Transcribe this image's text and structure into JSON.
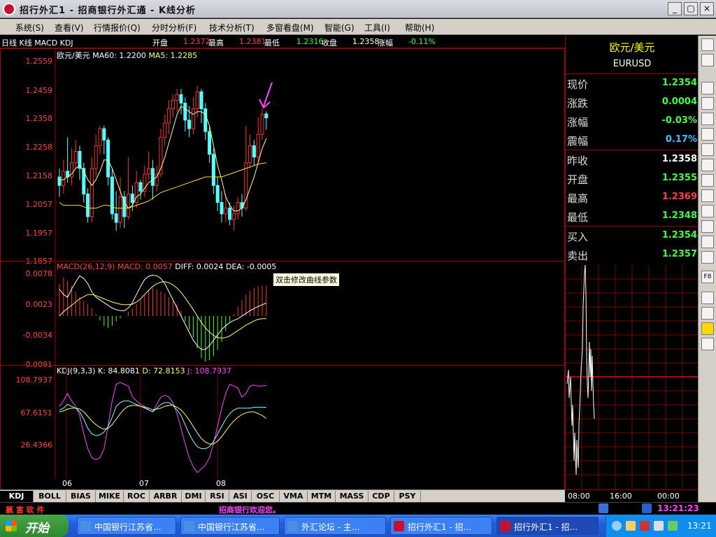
{
  "window": {
    "title": "招行外汇1 - 招商银行外汇通 - K线分析",
    "min_label": "_",
    "max_label": "▢",
    "close_label": "×"
  },
  "menu": [
    "系统(S)",
    "查看(V)",
    "行情报价(Q)",
    "分时分析(F)",
    "技术分析(T)",
    "多窗看盘(M)",
    "智能(G)",
    "工具(I)",
    "帮助(H)"
  ],
  "info": {
    "title": "日线 K线 MACD KDJ",
    "open_label": "开盘",
    "open": "1.2372",
    "high_label": "最高",
    "high": "1.2381",
    "low_label": "最低",
    "low": "1.2316",
    "close_label": "收盘",
    "close": "1.2358",
    "change_label": "涨幅",
    "change": "-0.11%"
  },
  "price_panel": {
    "legend_name": "欧元/美元",
    "ma60": "MA60: 1.2200",
    "ma5": "MA5: 1.2285",
    "y_ticks": [
      "1.2559",
      "1.2459",
      "1.2358",
      "1.2258",
      "1.2158",
      "1.2057",
      "1.1957",
      "1.1857"
    ]
  },
  "macd_panel": {
    "header": "MACD(26,12,9)",
    "macd": "MACD: 0.0057",
    "diff": "DIFF: 0.0024",
    "dea": "DEA: -0.0005",
    "y_ticks": [
      "0.0078",
      "0.0023",
      "-0.0034",
      "-0.0091"
    ],
    "tooltip": "双击修改曲线参数"
  },
  "kdj_panel": {
    "header": "KDJ(9,3,3)",
    "k": "K: 84.8081",
    "d": "D: 72.8153",
    "j": "J: 108.7937",
    "y_ticks": [
      "108.7937",
      "67.6151",
      "26.4366"
    ]
  },
  "x_ticks": [
    "06",
    "07",
    "08"
  ],
  "quote": {
    "name": "欧元/美元",
    "code": "EURUSD",
    "rows": [
      {
        "label": "现价",
        "value": "1.2354",
        "color": "#40ff40"
      },
      {
        "label": "涨跌",
        "value": "0.0004",
        "color": "#40ff40"
      },
      {
        "label": "涨幅",
        "value": "-0.03%",
        "color": "#40ff40"
      },
      {
        "label": "震幅",
        "value": "0.17%",
        "color": "#40c0ff"
      },
      {
        "label": "昨收",
        "value": "1.2358",
        "color": "#ffffff"
      },
      {
        "label": "开盘",
        "value": "1.2355",
        "color": "#40ff40"
      },
      {
        "label": "最高",
        "value": "1.2369",
        "color": "#ff4040"
      },
      {
        "label": "最低",
        "value": "1.2348",
        "color": "#40ff40"
      },
      {
        "label": "买入",
        "value": "1.2354",
        "color": "#40ff40"
      },
      {
        "label": "卖出",
        "value": "1.2357",
        "color": "#40ff40"
      }
    ]
  },
  "time_ticks": [
    "08:00",
    "16:00",
    "00:00"
  ],
  "tabs": [
    "KDJ",
    "BOLL",
    "BIAS",
    "MIKE",
    "ROC",
    "ARBR",
    "DMI",
    "RSI",
    "ASI",
    "OSC",
    "VMA",
    "MTM",
    "MASS",
    "CDP",
    "PSY"
  ],
  "status": {
    "brand": "嬴 富 软 件",
    "welcome": "招商银行欢迎您。",
    "clock": "13:21:23"
  },
  "taskbar": {
    "start": "开始",
    "tasks": [
      "中国银行江苏省...",
      "中国银行江苏省...",
      "外汇论坛 - 主...",
      "招行外汇1 - 招...",
      "招行外汇1 - 招..."
    ],
    "clock": "13:21"
  },
  "chart_data": {
    "type": "candlestick",
    "title": "日线 K线",
    "series_name": "欧元/美元",
    "ylim": [
      1.1857,
      1.2559
    ],
    "x_ticks": [
      "06",
      "07",
      "08"
    ],
    "candles": [
      [
        1.215,
        1.212,
        1.218,
        1.208
      ],
      [
        1.212,
        1.217,
        1.221,
        1.209
      ],
      [
        1.217,
        1.215,
        1.229,
        1.213
      ],
      [
        1.215,
        1.22,
        1.225,
        1.212
      ],
      [
        1.22,
        1.224,
        1.228,
        1.218
      ],
      [
        1.224,
        1.218,
        1.226,
        1.214
      ],
      [
        1.218,
        1.209,
        1.22,
        1.206
      ],
      [
        1.209,
        1.201,
        1.211,
        1.199
      ],
      [
        1.201,
        1.218,
        1.222,
        1.199
      ],
      [
        1.218,
        1.226,
        1.23,
        1.215
      ],
      [
        1.226,
        1.232,
        1.233,
        1.223
      ],
      [
        1.232,
        1.228,
        1.233,
        1.223
      ],
      [
        1.228,
        1.215,
        1.229,
        1.212
      ],
      [
        1.215,
        1.202,
        1.218,
        1.2
      ],
      [
        1.202,
        1.199,
        1.21,
        1.196
      ],
      [
        1.199,
        1.208,
        1.215,
        1.197
      ],
      [
        1.208,
        1.201,
        1.21,
        1.197
      ],
      [
        1.201,
        1.209,
        1.222,
        1.2
      ],
      [
        1.209,
        1.206,
        1.212,
        1.203
      ],
      [
        1.206,
        1.213,
        1.217,
        1.204
      ],
      [
        1.213,
        1.21,
        1.214,
        1.207
      ],
      [
        1.21,
        1.216,
        1.219,
        1.208
      ],
      [
        1.216,
        1.218,
        1.224,
        1.214
      ],
      [
        1.218,
        1.212,
        1.221,
        1.207
      ],
      [
        1.212,
        1.216,
        1.219,
        1.21
      ],
      [
        1.216,
        1.229,
        1.232,
        1.215
      ],
      [
        1.229,
        1.234,
        1.237,
        1.226
      ],
      [
        1.234,
        1.239,
        1.242,
        1.23
      ],
      [
        1.239,
        1.242,
        1.244,
        1.236
      ],
      [
        1.242,
        1.244,
        1.246,
        1.238
      ],
      [
        1.244,
        1.241,
        1.246,
        1.237
      ],
      [
        1.241,
        1.235,
        1.243,
        1.231
      ],
      [
        1.235,
        1.232,
        1.24,
        1.229
      ],
      [
        1.232,
        1.239,
        1.243,
        1.23
      ],
      [
        1.239,
        1.245,
        1.247,
        1.236
      ],
      [
        1.245,
        1.239,
        1.246,
        1.234
      ],
      [
        1.239,
        1.231,
        1.241,
        1.228
      ],
      [
        1.231,
        1.223,
        1.233,
        1.22
      ],
      [
        1.223,
        1.212,
        1.225,
        1.209
      ],
      [
        1.212,
        1.206,
        1.215,
        1.203
      ],
      [
        1.206,
        1.202,
        1.21,
        1.199
      ],
      [
        1.202,
        1.204,
        1.209,
        1.199
      ],
      [
        1.204,
        1.2,
        1.206,
        1.198
      ],
      [
        1.2,
        1.202,
        1.205,
        1.196
      ],
      [
        1.202,
        1.206,
        1.208,
        1.2
      ],
      [
        1.206,
        1.204,
        1.209,
        1.201
      ],
      [
        1.204,
        1.22,
        1.233,
        1.203
      ],
      [
        1.22,
        1.226,
        1.23,
        1.218
      ],
      [
        1.226,
        1.222,
        1.228,
        1.219
      ],
      [
        1.222,
        1.23,
        1.236,
        1.22
      ],
      [
        1.23,
        1.237,
        1.239,
        1.228
      ],
      [
        1.2372,
        1.2358,
        1.2381,
        1.2316
      ]
    ],
    "ma5": [
      1.214,
      1.214,
      1.215,
      1.216,
      1.218,
      1.219,
      1.217,
      1.214,
      1.212,
      1.214,
      1.217,
      1.221,
      1.221,
      1.218,
      1.214,
      1.21,
      1.206,
      1.204,
      1.205,
      1.208,
      1.209,
      1.211,
      1.213,
      1.214,
      1.215,
      1.218,
      1.222,
      1.227,
      1.232,
      1.237,
      1.24,
      1.239,
      1.238,
      1.237,
      1.238,
      1.238,
      1.237,
      1.233,
      1.226,
      1.219,
      1.214,
      1.208,
      1.205,
      1.203,
      1.203,
      1.204,
      1.207,
      1.211,
      1.215,
      1.22,
      1.225,
      1.2285
    ],
    "ma60": [
      1.206,
      1.205,
      1.205,
      1.205,
      1.205,
      1.205,
      1.2045,
      1.204,
      1.204,
      1.204,
      1.2045,
      1.205,
      1.205,
      1.2045,
      1.204,
      1.204,
      1.204,
      1.204,
      1.2045,
      1.205,
      1.2055,
      1.206,
      1.2065,
      1.2075,
      1.2085,
      1.2095,
      1.21,
      1.2105,
      1.211,
      1.2115,
      1.212,
      1.2125,
      1.213,
      1.2135,
      1.214,
      1.2145,
      1.215,
      1.215,
      1.215,
      1.215,
      1.215,
      1.2155,
      1.216,
      1.2165,
      1.217,
      1.2175,
      1.218,
      1.2185,
      1.219,
      1.2195,
      1.2198,
      1.22
    ],
    "macd_ylim": [
      -0.0091,
      0.0078
    ],
    "macd_hist": [
      0.006,
      0.0072,
      0.0066,
      0.0056,
      0.0045,
      0.0035,
      0.0028,
      0.0022,
      0.0014,
      0.0004,
      -0.0008,
      -0.0018,
      -0.0022,
      -0.0018,
      -0.001,
      -0.0004,
      0.0,
      0.0008,
      0.0014,
      0.0022,
      0.003,
      0.004,
      0.0048,
      0.0052,
      0.005,
      0.0046,
      0.0042,
      0.0035,
      0.0028,
      0.0022,
      0.001,
      -0.001,
      -0.0025,
      -0.004,
      -0.006,
      -0.0078,
      -0.0085,
      -0.0082,
      -0.0074,
      -0.0063,
      -0.0048,
      -0.0028,
      -0.001,
      0.0004,
      0.0018,
      0.003,
      0.004,
      0.0047,
      0.0052,
      0.0055,
      0.0057,
      0.0057
    ],
    "macd_diff": [
      0.005,
      0.004,
      0.0035,
      0.005,
      0.0063,
      0.0075,
      0.007,
      0.006,
      0.0045,
      0.0035,
      0.003,
      0.0025,
      0.002,
      0.0015,
      0.0012,
      0.001,
      0.001,
      0.0015,
      0.0025,
      0.004,
      0.0055,
      0.0068,
      0.0074,
      0.0076,
      0.0075,
      0.007,
      0.006,
      0.0045,
      0.003,
      0.0015,
      0.0,
      -0.0015,
      -0.003,
      -0.0045,
      -0.0055,
      -0.0062,
      -0.0062,
      -0.0055,
      -0.0045,
      -0.0035,
      -0.0025,
      -0.0018,
      -0.0012,
      -0.0008,
      -0.0005,
      0.0,
      0.0005,
      0.001,
      0.0014,
      0.0018,
      0.0021,
      0.0024
    ],
    "macd_dea": [
      0.0,
      0.0008,
      0.0014,
      0.002,
      0.0026,
      0.0032,
      0.0036,
      0.004,
      0.004,
      0.0038,
      0.0035,
      0.0032,
      0.0029,
      0.0026,
      0.0024,
      0.0022,
      0.0021,
      0.0021,
      0.0022,
      0.0026,
      0.0032,
      0.004,
      0.0048,
      0.0055,
      0.006,
      0.0063,
      0.0064,
      0.0062,
      0.0058,
      0.0052,
      0.0044,
      0.0034,
      0.0023,
      0.0012,
      0.0,
      -0.0012,
      -0.0022,
      -0.003,
      -0.0036,
      -0.004,
      -0.0041,
      -0.004,
      -0.0037,
      -0.0032,
      -0.0027,
      -0.0022,
      -0.0017,
      -0.0013,
      -0.0009,
      -0.0006,
      -0.0005,
      -0.0005
    ],
    "kdj_ylim": [
      10,
      118
    ],
    "kdj_k": [
      82,
      84,
      88,
      86,
      84,
      80,
      72,
      62,
      56,
      54,
      55,
      58,
      64,
      74,
      86,
      90,
      92,
      92,
      90,
      88,
      86,
      84,
      82,
      80,
      84,
      88,
      90,
      90,
      87,
      82,
      76,
      66,
      56,
      48,
      42,
      40,
      40,
      42,
      48,
      56,
      64,
      72,
      78,
      82,
      84,
      84,
      84,
      84,
      85,
      85,
      85,
      84.8
    ],
    "kdj_d": [
      80,
      81,
      83,
      84,
      84,
      83,
      80,
      75,
      70,
      66,
      63,
      61,
      62,
      66,
      72,
      78,
      83,
      86,
      87,
      87,
      86,
      85,
      84,
      82,
      83,
      84,
      86,
      87,
      87,
      85,
      82,
      77,
      71,
      64,
      57,
      51,
      47,
      45,
      45,
      48,
      53,
      59,
      65,
      70,
      74,
      77,
      79,
      80,
      80,
      78,
      76,
      72.8
    ],
    "kdj_j": [
      86,
      92,
      100,
      92,
      86,
      76,
      56,
      40,
      30,
      28,
      30,
      40,
      65,
      92,
      110,
      112,
      110,
      108,
      96,
      92,
      88,
      86,
      82,
      80,
      88,
      96,
      98,
      96,
      90,
      78,
      62,
      45,
      30,
      20,
      14,
      18,
      22,
      30,
      46,
      64,
      84,
      100,
      110,
      108,
      106,
      96,
      100,
      108,
      109,
      108,
      108,
      108.8
    ]
  }
}
